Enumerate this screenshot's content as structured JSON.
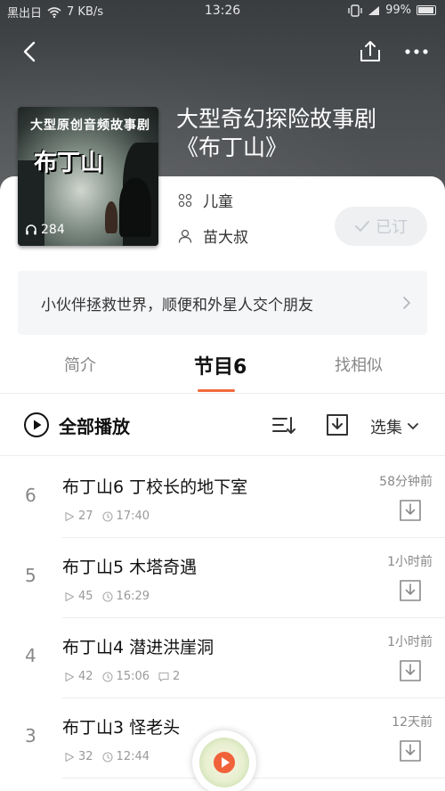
{
  "status_bar": {
    "carrier": "黑出日",
    "network_speed": "7 KB/s",
    "time": "13:26",
    "battery": "99%"
  },
  "album": {
    "cover_top_text": "大型原创音频故事剧",
    "cover_title": "布丁山",
    "cover_play_count": "284",
    "title_line1": "大型奇幻探险故事剧",
    "title_line2": "《布丁山》",
    "category": "儿童",
    "author": "苗大叔",
    "subscribe_label": "已订",
    "description": "小伙伴拯救世界，顺便和外星人交个朋友"
  },
  "tabs": [
    {
      "label": "简介"
    },
    {
      "label": "节目6"
    },
    {
      "label": "找相似"
    }
  ],
  "toolbar": {
    "play_all_label": "全部播放",
    "select_label": "选集"
  },
  "episodes": [
    {
      "num": "6",
      "title": "布丁山6 丁校长的地下室",
      "plays": "27",
      "duration": "17:40",
      "comments": "",
      "time_ago": "58分钟前"
    },
    {
      "num": "5",
      "title": "布丁山5 木塔奇遇",
      "plays": "45",
      "duration": "16:29",
      "comments": "",
      "time_ago": "1小时前"
    },
    {
      "num": "4",
      "title": "布丁山4 潜进洪崖洞",
      "plays": "42",
      "duration": "15:06",
      "comments": "2",
      "time_ago": "1小时前"
    },
    {
      "num": "3",
      "title": "布丁山3 怪老头",
      "plays": "32",
      "duration": "12:44",
      "comments": "",
      "time_ago": "12天前"
    }
  ],
  "icons": {
    "back": "back-arrow-icon",
    "share": "share-icon",
    "more": "more-icon",
    "category": "grid-icon",
    "author": "person-icon",
    "check": "check-icon",
    "play_all": "play-circle-icon",
    "sort": "sort-icon",
    "download": "download-icon"
  },
  "colors": {
    "accent": "#f26b3a",
    "tab_inactive": "#888888",
    "subscribed_bg": "#eef0f2"
  }
}
